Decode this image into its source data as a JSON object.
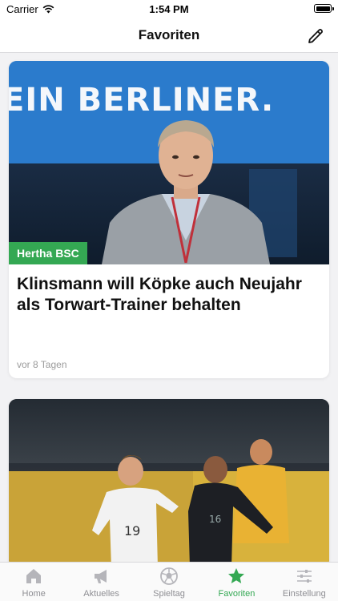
{
  "status_bar": {
    "carrier": "Carrier",
    "time": "1:54 PM"
  },
  "nav": {
    "title": "Favoriten",
    "edit_icon": "pencil-icon"
  },
  "articles": [
    {
      "tag": "Hertha BSC",
      "headline": "Klinsmann will Köpke auch Neujahr als Torwart-Trainer behalten",
      "time_ago": "vor 8 Tagen",
      "image_banner_text": "EIN BERLINER."
    },
    {
      "image_description_icon": "football-players-photo"
    }
  ],
  "tabs": [
    {
      "label": "Home",
      "icon": "home-icon",
      "active": false
    },
    {
      "label": "Aktuelles",
      "icon": "megaphone-icon",
      "active": false
    },
    {
      "label": "Spieltag",
      "icon": "soccer-ball-icon",
      "active": false
    },
    {
      "label": "Favoriten",
      "icon": "star-icon",
      "active": true
    },
    {
      "label": "Einstellung",
      "icon": "sliders-icon",
      "active": false
    }
  ],
  "colors": {
    "accent": "#34a853",
    "inactive": "#8e8e93",
    "banner_blue": "#2b7bcc"
  }
}
